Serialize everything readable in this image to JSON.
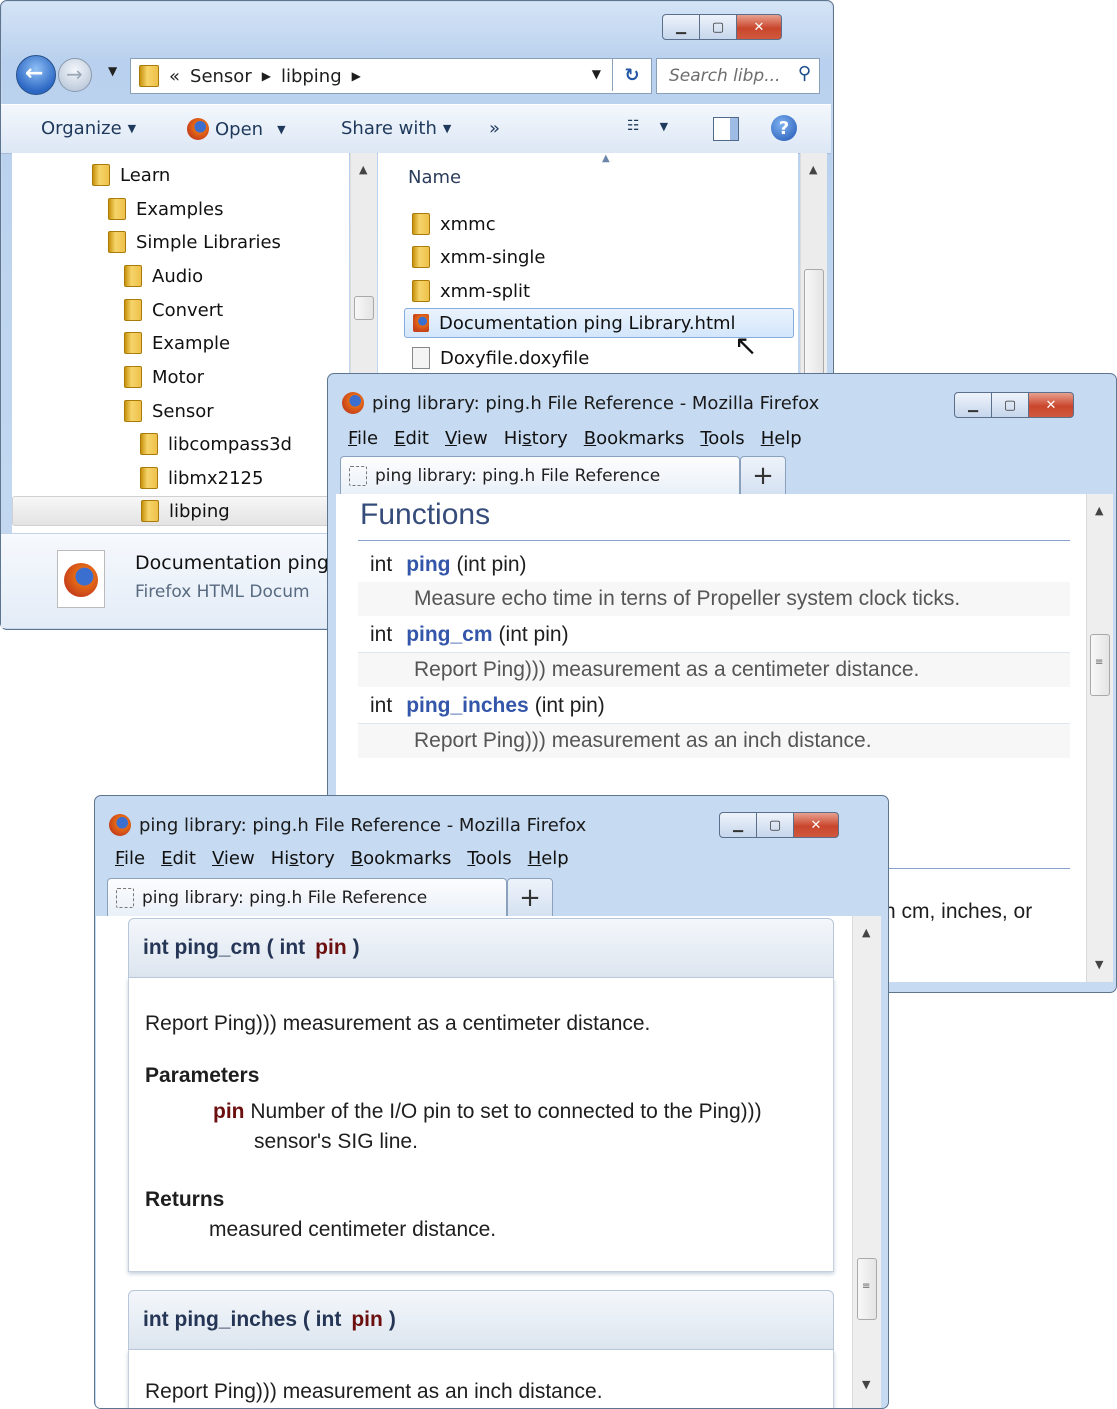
{
  "explorer": {
    "breadcrumb": [
      "«",
      "Sensor",
      "libping"
    ],
    "search_placeholder": "Search libp...",
    "toolbar": {
      "organize": "Organize",
      "open": "Open",
      "share": "Share with",
      "more": "»"
    },
    "tree": [
      "Learn",
      "Examples",
      "Simple Libraries",
      "Audio",
      "Convert",
      "Example",
      "Motor",
      "Sensor",
      "libcompass3d",
      "libmx2125",
      "libping"
    ],
    "list_header": "Name",
    "files": [
      "xmmc",
      "xmm-single",
      "xmm-split",
      "Documentation ping Library.html",
      "Doxyfile.doxyfile"
    ],
    "details": {
      "name": "Documentation ping",
      "type": "Firefox HTML Docum"
    }
  },
  "firefox": {
    "title": "ping library: ping.h File Reference - Mozilla Firefox",
    "menu": [
      {
        "u": "F",
        "rest": "ile"
      },
      {
        "u": "E",
        "rest": "dit"
      },
      {
        "u": "V",
        "rest": "iew"
      },
      {
        "pre": "Hi",
        "u": "s",
        "rest": "tory"
      },
      {
        "u": "B",
        "rest": "ookmarks"
      },
      {
        "u": "T",
        "rest": "ools"
      },
      {
        "u": "H",
        "rest": "elp"
      }
    ],
    "tab_label": "ping library: ping.h File Reference",
    "new_tab": "+"
  },
  "functions_page": {
    "heading": "Functions",
    "items": [
      {
        "type": "int",
        "name": "ping",
        "args": "(int pin)",
        "desc": "Measure echo time in terns of Propeller system clock ticks."
      },
      {
        "type": "int",
        "name": "ping_cm",
        "args": "(int pin)",
        "desc": "Report Ping))) measurement as a centimeter distance."
      },
      {
        "type": "int",
        "name": "ping_inches",
        "args": "(int pin)",
        "desc": "Report Ping))) measurement as an inch distance."
      }
    ],
    "partial_text": "n cm, inches, or"
  },
  "detail_page": {
    "cm": {
      "sig_type": "int ping_cm ( int",
      "sig_param": "pin",
      "sig_close": ")",
      "brief": "Report Ping))) measurement as a centimeter distance.",
      "params_label": "Parameters",
      "param_name": "pin",
      "param_desc": "Number of the I/O pin to set to connected to the Ping)))",
      "param_desc2": "sensor's SIG line.",
      "returns_label": "Returns",
      "returns_desc": "measured centimeter distance."
    },
    "inches": {
      "sig_type": "int ping_inches ( int",
      "sig_param": "pin",
      "sig_close": ")",
      "brief": "Report Ping))) measurement as an inch distance."
    }
  }
}
